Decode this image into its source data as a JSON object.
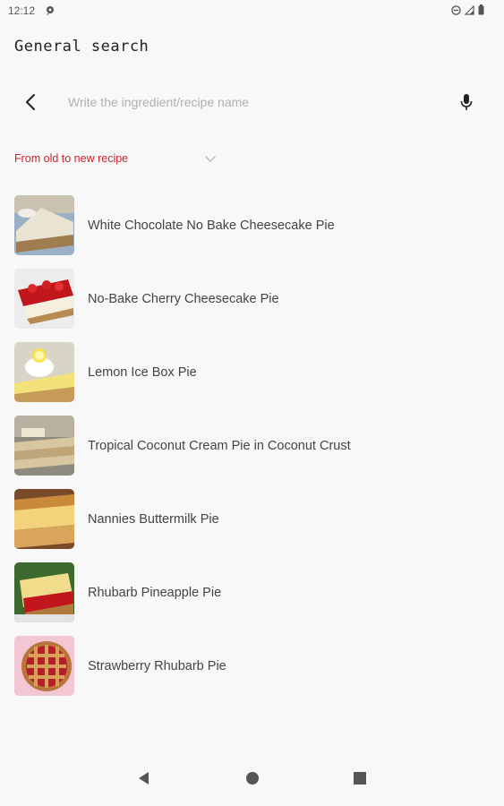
{
  "status": {
    "time": "12:12"
  },
  "header": {
    "title": "General search"
  },
  "search": {
    "placeholder": "Write the ingredient/recipe name",
    "value": ""
  },
  "sort": {
    "selected": "From old to new recipe"
  },
  "recipes": [
    {
      "name": "White Chocolate No Bake Cheesecake Pie"
    },
    {
      "name": "No-Bake Cherry Cheesecake Pie"
    },
    {
      "name": "Lemon Ice Box Pie"
    },
    {
      "name": "Tropical Coconut Cream Pie in Coconut Crust"
    },
    {
      "name": "Nannies Buttermilk Pie"
    },
    {
      "name": "Rhubarb Pineapple Pie"
    },
    {
      "name": "Strawberry Rhubarb Pie"
    }
  ],
  "colors": {
    "accent": "#d0202a",
    "background": "#f8f8f8"
  },
  "icons": {
    "back": "chevron-left-icon",
    "mic": "microphone-icon",
    "sort": "chevron-down-icon",
    "nav_back": "triangle-back-icon",
    "nav_home": "circle-home-icon",
    "nav_recents": "square-recents-icon"
  }
}
